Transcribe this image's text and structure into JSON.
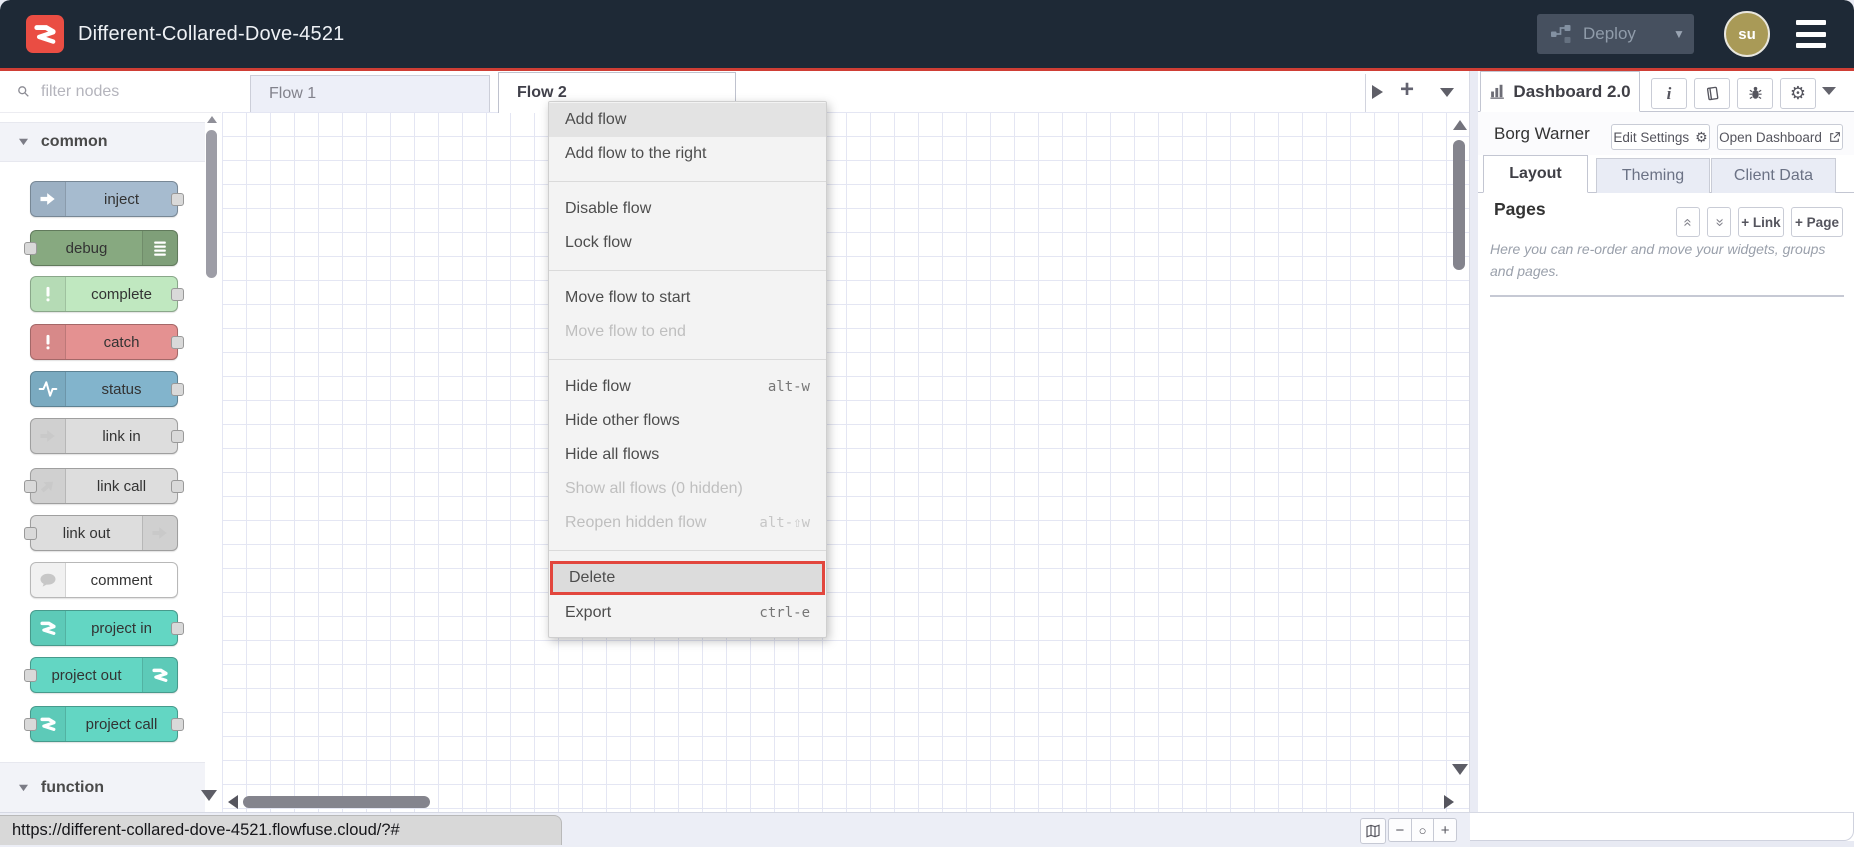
{
  "theme": {
    "header_bg": "#1e2936",
    "accent_red": "#cf3e35",
    "logo_red": "#ea4d43",
    "avatar_gold": "#a99a57",
    "grid_line": "#e4e6f3",
    "menu_danger_border": "#e2463d"
  },
  "header": {
    "title": "Different-Collared-Dove-4521",
    "deploy": {
      "label": "Deploy"
    },
    "avatar": {
      "initials": "su"
    }
  },
  "palette": {
    "filter_placeholder": "filter nodes",
    "category_common": "common",
    "category_function": "function",
    "nodes": [
      {
        "label": "inject",
        "color": "#a6bbcf",
        "icon": "arrow-in-icon",
        "ports": "out"
      },
      {
        "label": "debug",
        "color": "#87a980",
        "icon": "debug-lines-icon",
        "ports": "in"
      },
      {
        "label": "complete",
        "color": "#c0e8c0",
        "icon": "exclamation-icon",
        "ports": "out"
      },
      {
        "label": "catch",
        "color": "#e49191",
        "icon": "exclamation-icon",
        "ports": "out"
      },
      {
        "label": "status",
        "color": "#82b4cc",
        "icon": "pulse-icon",
        "ports": "out"
      },
      {
        "label": "link in",
        "color": "#dddddd",
        "icon": "link-arrow-icon",
        "ports": "out"
      },
      {
        "label": "link call",
        "color": "#dddddd",
        "icon": "link-call-icon",
        "ports": "both"
      },
      {
        "label": "link out",
        "color": "#dddddd",
        "icon": "link-arrow-icon",
        "ports": "in"
      },
      {
        "label": "comment",
        "color": "#ffffff",
        "icon": "comment-bubble-icon",
        "ports": "none"
      },
      {
        "label": "project in",
        "color": "#63d6c3",
        "icon": "project-icon",
        "ports": "out"
      },
      {
        "label": "project out",
        "color": "#63d6c3",
        "icon": "project-icon",
        "ports": "in"
      },
      {
        "label": "project call",
        "color": "#63d6c3",
        "icon": "project-icon",
        "ports": "both"
      }
    ]
  },
  "workspace": {
    "tabs": [
      {
        "label": "Flow 1",
        "active": false
      },
      {
        "label": "Flow 2",
        "active": true
      }
    ]
  },
  "context_menu": {
    "items": [
      {
        "label": "Add flow",
        "state": "hover"
      },
      {
        "label": "Add flow to the right"
      },
      {
        "label": "Disable flow"
      },
      {
        "label": "Lock flow"
      },
      {
        "label": "Move flow to start"
      },
      {
        "label": "Move flow to end",
        "state": "disabled"
      },
      {
        "label": "Hide flow",
        "shortcut": "alt-w"
      },
      {
        "label": "Hide other flows"
      },
      {
        "label": "Hide all flows"
      },
      {
        "label": "Show all flows (0 hidden)",
        "state": "disabled"
      },
      {
        "label": "Reopen hidden flow",
        "shortcut": "alt-⇧w",
        "state": "disabled"
      },
      {
        "label": "Delete",
        "state": "selected-danger"
      },
      {
        "label": "Export",
        "shortcut": "ctrl-e"
      }
    ]
  },
  "sidebar": {
    "tab_label": "Dashboard 2.0",
    "dashboard_name": "Borg Warner",
    "edit_settings_label": "Edit Settings",
    "open_dashboard_label": "Open Dashboard",
    "tabs": [
      {
        "label": "Layout",
        "active": true
      },
      {
        "label": "Theming",
        "active": false
      },
      {
        "label": "Client Data",
        "active": false
      }
    ],
    "pages": {
      "title": "Pages",
      "link_button": "+ Link",
      "page_button": "+ Page",
      "help_text": "Here you can re-order and move your widgets, groups and pages."
    }
  },
  "statusbar": {
    "url": "https://different-collared-dove-4521.flowfuse.cloud/?#"
  }
}
